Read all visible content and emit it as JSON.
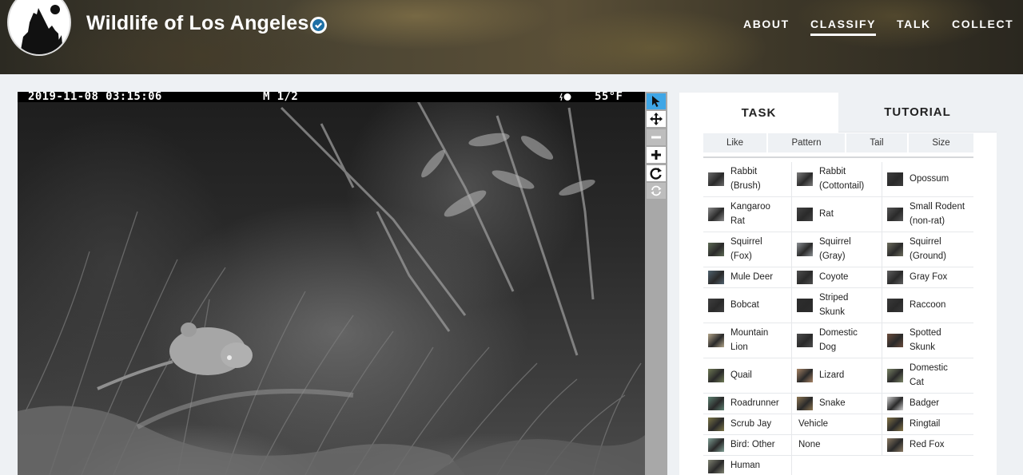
{
  "site": {
    "title": "Wildlife of Los Angeles",
    "logo_icon": "howling-coyote-logo",
    "verified_icon": "check-badge-icon"
  },
  "nav": {
    "items": [
      {
        "label": "ABOUT",
        "active": false
      },
      {
        "label": "CLASSIFY",
        "active": true
      },
      {
        "label": "TALK",
        "active": false
      },
      {
        "label": "COLLECT",
        "active": false
      }
    ]
  },
  "camera": {
    "timestamp": "2019-11-08 03:15:06",
    "mode": "M 1/2",
    "moon_icon": "moon-phase-icon",
    "temperature": "55°F"
  },
  "toolbar": {
    "tools": [
      {
        "icon": "pointer-icon",
        "state": "active"
      },
      {
        "icon": "move-icon",
        "state": "normal"
      },
      {
        "icon": "zoom-out-icon",
        "state": "disabled"
      },
      {
        "icon": "zoom-in-icon",
        "state": "normal"
      },
      {
        "icon": "rotate-icon",
        "state": "normal"
      },
      {
        "icon": "reset-icon",
        "state": "disabled"
      }
    ]
  },
  "panel": {
    "tabs": {
      "task": "TASK",
      "tutorial": "TUTORIAL"
    },
    "filters": [
      "Like",
      "Pattern",
      "Tail",
      "Size"
    ],
    "choices": [
      {
        "label": "Rabbit (Brush)",
        "lines": [
          "Rabbit",
          "(Brush)"
        ],
        "thumb": "#6a6a6a"
      },
      {
        "label": "Rabbit (Cottontail)",
        "lines": [
          "Rabbit",
          "(Cottontail)"
        ],
        "thumb": "#7c7c7c"
      },
      {
        "label": "Opossum",
        "lines": [
          "Opossum"
        ],
        "thumb": "#3e3e3e"
      },
      {
        "label": "Kangaroo Rat",
        "lines": [
          "Kangaroo",
          "Rat"
        ],
        "thumb": "#8a8a8a"
      },
      {
        "label": "Rat",
        "lines": [
          "Rat"
        ],
        "thumb": "#444444"
      },
      {
        "label": "Small Rodent (non-rat)",
        "lines": [
          "Small Rodent",
          "(non-rat)"
        ],
        "thumb": "#555555"
      },
      {
        "label": "Squirrel (Fox)",
        "lines": [
          "Squirrel",
          "(Fox)"
        ],
        "thumb": "#5e6a55"
      },
      {
        "label": "Squirrel (Gray)",
        "lines": [
          "Squirrel",
          "(Gray)"
        ],
        "thumb": "#8c9094"
      },
      {
        "label": "Squirrel (Ground)",
        "lines": [
          "Squirrel",
          "(Ground)"
        ],
        "thumb": "#6d6d5e"
      },
      {
        "label": "Mule Deer",
        "lines": [
          "Mule Deer"
        ],
        "thumb": "#50626e"
      },
      {
        "label": "Coyote",
        "lines": [
          "Coyote"
        ],
        "thumb": "#4f4f4f"
      },
      {
        "label": "Gray Fox",
        "lines": [
          "Gray Fox"
        ],
        "thumb": "#5f5f5f"
      },
      {
        "label": "Bobcat",
        "lines": [
          "Bobcat"
        ],
        "thumb": "#3f3f3f"
      },
      {
        "label": "Striped Skunk",
        "lines": [
          "Striped",
          "Skunk"
        ],
        "thumb": "#2e2e2e"
      },
      {
        "label": "Raccoon",
        "lines": [
          "Raccoon"
        ],
        "thumb": "#3a3a3a"
      },
      {
        "label": "Mountain Lion",
        "lines": [
          "Mountain",
          "Lion"
        ],
        "thumb": "#b3a58a"
      },
      {
        "label": "Domestic Dog",
        "lines": [
          "Domestic",
          "Dog"
        ],
        "thumb": "#4c4c4c"
      },
      {
        "label": "Spotted Skunk",
        "lines": [
          "Spotted",
          "Skunk"
        ],
        "thumb": "#6a4c3c"
      },
      {
        "label": "Quail",
        "lines": [
          "Quail"
        ],
        "thumb": "#6f7a55"
      },
      {
        "label": "Lizard",
        "lines": [
          "Lizard"
        ],
        "thumb": "#a88466"
      },
      {
        "label": "Domestic Cat",
        "lines": [
          "Domestic",
          "Cat"
        ],
        "thumb": "#7a8466"
      },
      {
        "label": "Roadrunner",
        "lines": [
          "Roadrunner"
        ],
        "thumb": "#5d8272"
      },
      {
        "label": "Snake",
        "lines": [
          "Snake"
        ],
        "thumb": "#8d7653"
      },
      {
        "label": "Badger",
        "lines": [
          "Badger"
        ],
        "thumb": "#cfcfcf"
      },
      {
        "label": "Scrub Jay",
        "lines": [
          "Scrub Jay"
        ],
        "thumb": "#7d7748"
      },
      {
        "label": "Vehicle",
        "lines": [
          "Vehicle"
        ],
        "thumb": ""
      },
      {
        "label": "Ringtail",
        "lines": [
          "Ringtail"
        ],
        "thumb": "#857548"
      },
      {
        "label": "Bird: Other",
        "lines": [
          "Bird: Other"
        ],
        "thumb": "#809f95"
      },
      {
        "label": "None",
        "lines": [
          "None"
        ],
        "thumb": ""
      },
      {
        "label": "Red Fox",
        "lines": [
          "Red Fox"
        ],
        "thumb": "#8a7a63"
      },
      {
        "label": "Human",
        "lines": [
          "Human"
        ],
        "thumb": "#7f8272"
      }
    ]
  },
  "colors": {
    "accent": "#3fa6e6",
    "panel_bg": "#eef1f4"
  }
}
